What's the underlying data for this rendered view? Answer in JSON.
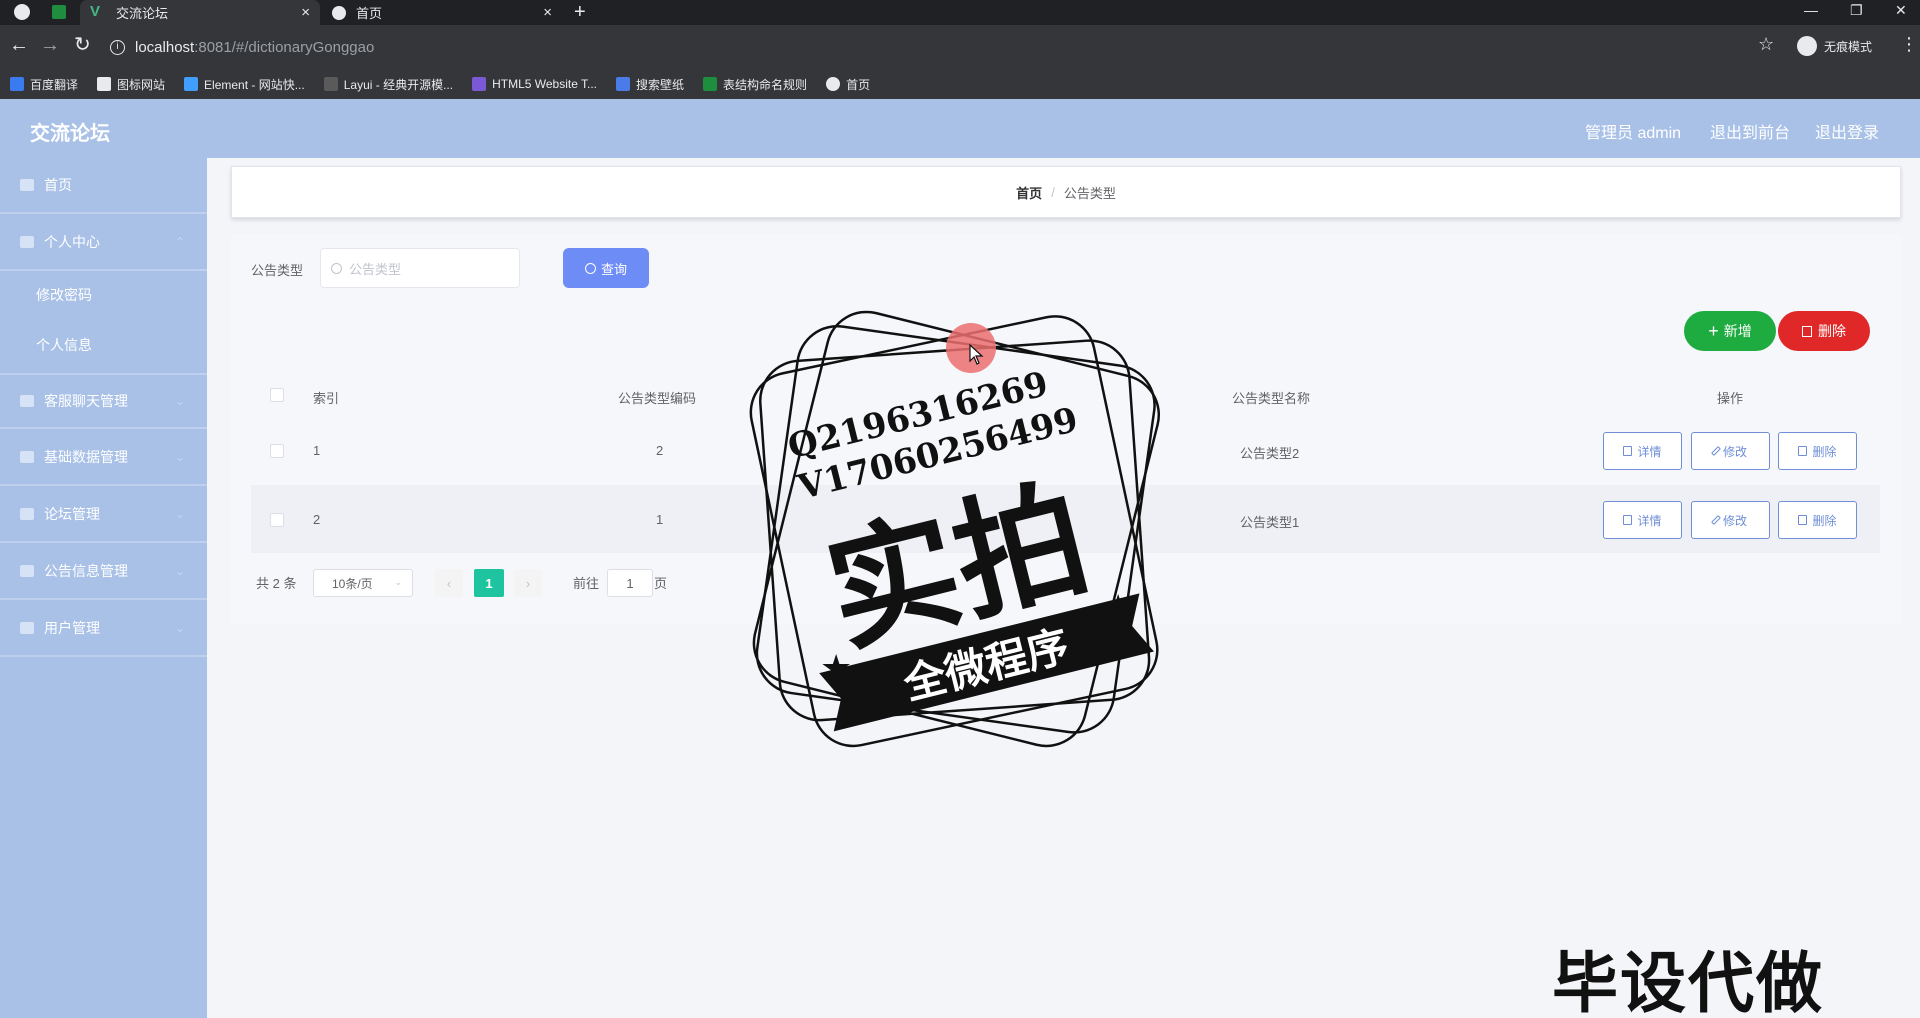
{
  "browser": {
    "tabs": [
      {
        "title": "交流论坛",
        "active": true
      },
      {
        "title": "首页",
        "active": false
      }
    ],
    "url_host": "localhost",
    "url_rest": ":8081/#/dictionaryGonggao",
    "incognito_label": "无痕模式",
    "bookmarks": [
      "百度翻译",
      "图标网站",
      "Element - 网站快...",
      "Layui - 经典开源模...",
      "HTML5 Website T...",
      "搜索壁纸",
      "表结构命名规则",
      "首页"
    ]
  },
  "header": {
    "title": "交流论坛",
    "user": "管理员 admin",
    "to_front": "退出到前台",
    "logout": "退出登录"
  },
  "sidebar": {
    "items": [
      {
        "label": "首页",
        "icon": "home-icon"
      },
      {
        "label": "个人中心",
        "icon": "user-icon"
      },
      {
        "label": "修改密码"
      },
      {
        "label": "个人信息"
      },
      {
        "label": "客服聊天管理",
        "icon": "chat-icon"
      },
      {
        "label": "基础数据管理",
        "icon": "grid-icon"
      },
      {
        "label": "论坛管理",
        "icon": "list-icon"
      },
      {
        "label": "公告信息管理",
        "icon": "notice-icon"
      },
      {
        "label": "用户管理",
        "icon": "users-icon"
      }
    ]
  },
  "breadcrumb": {
    "home": "首页",
    "sep": "/",
    "current": "公告类型"
  },
  "search": {
    "label": "公告类型",
    "placeholder": "公告类型",
    "query_button": "查询"
  },
  "actions": {
    "add": "新增",
    "delete": "删除"
  },
  "table": {
    "headers": [
      "索引",
      "公告类型编码",
      "公告类型名称",
      "操作"
    ],
    "rows": [
      {
        "index": "1",
        "code": "2",
        "name": "公告类型2"
      },
      {
        "index": "2",
        "code": "1",
        "name": "公告类型1"
      }
    ],
    "row_actions": {
      "detail": "详情",
      "edit": "修改",
      "delete": "删除"
    }
  },
  "pagination": {
    "total": "共 2 条",
    "page_size": "10条/页",
    "current_page": "1",
    "goto_label": "前往",
    "goto_value": "1",
    "page_suffix": "页"
  },
  "overlay": {
    "stamp_line1": "Q2196316269",
    "stamp_line2": "V17060256499",
    "stamp_big": "实拍",
    "stamp_ribbon": "全微程序",
    "corner_text": "毕设代做"
  },
  "colors": {
    "sidebar": "#a9c1e7",
    "primary": "#6e8cf6",
    "success": "#1eab3f",
    "danger": "#e02828",
    "page_active": "#1ec3a0"
  }
}
